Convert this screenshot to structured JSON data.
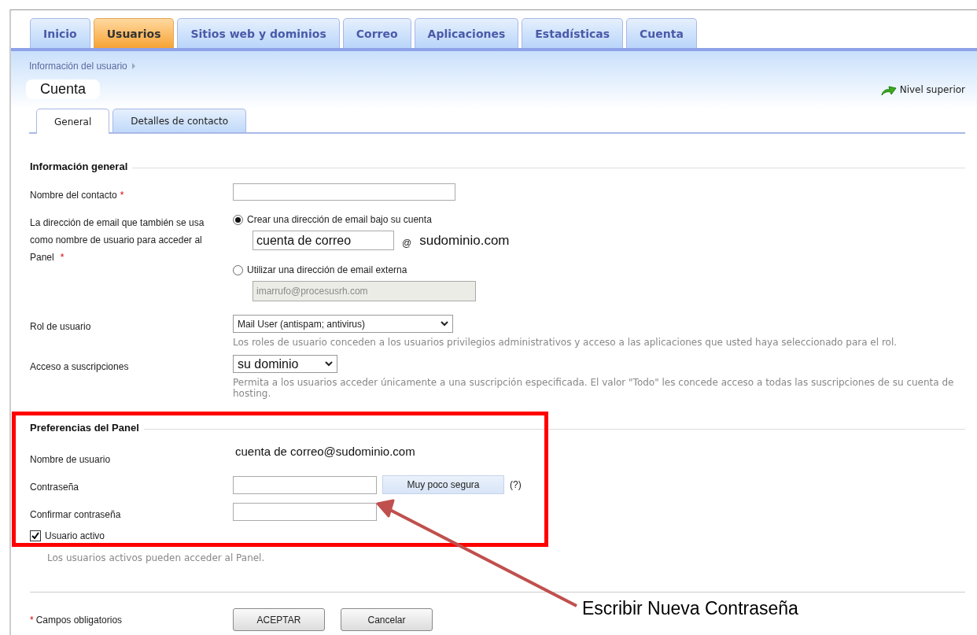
{
  "nav_tabs": [
    {
      "label": "Inicio",
      "selected": false
    },
    {
      "label": "Usuarios",
      "selected": true
    },
    {
      "label": "Sitios web y dominios",
      "selected": false
    },
    {
      "label": "Correo",
      "selected": false
    },
    {
      "label": "Aplicaciones",
      "selected": false
    },
    {
      "label": "Estadísticas",
      "selected": false
    },
    {
      "label": "Cuenta",
      "selected": false
    }
  ],
  "breadcrumb": "Información del usuario",
  "page_title": "Cuenta",
  "up_link": "Nivel superior",
  "sub_tabs": [
    {
      "label": "General",
      "selected": true
    },
    {
      "label": "Detalles de contacto",
      "selected": false
    }
  ],
  "sections": [
    {
      "title": "Información general",
      "rows": [
        {
          "kind": "text",
          "label": "Nombre del contacto",
          "mark": "*"
        },
        {
          "kind": "email",
          "label": "La dirección de email que también se usa como nombre de usuario para acceder al Panel",
          "mark": "*",
          "options": [
            {
              "label": "Crear una dirección de email bajo su cuenta",
              "selected": true,
              "local_part": "cuenta de correo",
              "at": "@",
              "domain": "sudominio.com"
            },
            {
              "label": "Utilizar una dirección de email externa",
              "selected": false,
              "value": "imarrufo@procesusrh.com",
              "disabled": true
            }
          ]
        },
        {
          "kind": "select",
          "label": "Rol de usuario",
          "value": "Mail User (antispam; antivirus)",
          "hint": "Los roles de usuario conceden a los usuarios privilegios administrativos y acceso a las aplicaciones que usted haya seleccionado para el rol."
        },
        {
          "kind": "select",
          "label": "Acceso a suscripciones",
          "value": "su dominio",
          "hint": "Permita a los usuarios acceder únicamente a una suscripción especificada. El valor \"Todo\" les concede acceso a todas las suscripciones de su cuenta de hosting."
        }
      ]
    },
    {
      "title": "Preferencias del Panel",
      "rows": [
        {
          "kind": "static",
          "label": "Nombre de usuario",
          "value": "cuenta de correo@sudominio.com"
        },
        {
          "kind": "password",
          "label": "Contraseña",
          "strength": "Muy poco segura",
          "help": "(?)"
        },
        {
          "kind": "password",
          "label": "Confirmar contraseña"
        },
        {
          "kind": "checkbox",
          "label": "Usuario activo",
          "checked": true,
          "hint": "Los usuarios activos pueden acceder al Panel."
        }
      ]
    }
  ],
  "footer": {
    "mark": "*",
    "note": "Campos obligatorios",
    "buttons": [
      "ACEPTAR",
      "Cancelar"
    ]
  },
  "annotation": {
    "text": "Escribir Nueva Contraseña"
  }
}
